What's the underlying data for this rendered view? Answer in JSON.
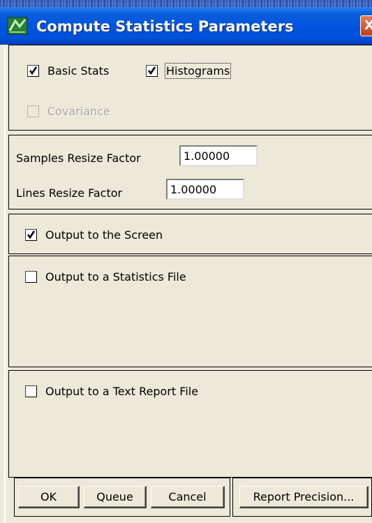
{
  "window": {
    "title": "Compute Statistics Parameters",
    "close_glyph": "X",
    "icon": "envi-app-icon"
  },
  "stats": {
    "basic_stats": {
      "label": "Basic Stats",
      "checked": true
    },
    "histograms": {
      "label": "Histograms",
      "checked": true
    },
    "covariance": {
      "label": "Covariance",
      "checked": false,
      "disabled": true
    }
  },
  "resize": {
    "samples_label": "Samples Resize Factor",
    "samples_value": "1.00000",
    "lines_label": "Lines Resize Factor",
    "lines_value": "1.00000"
  },
  "output_screen": {
    "label": "Output to the Screen",
    "checked": true
  },
  "output_stats_file": {
    "label": "Output to a Statistics File",
    "checked": false
  },
  "output_text_report": {
    "label": "Output to a Text Report File",
    "checked": false
  },
  "buttons": {
    "ok": "OK",
    "queue": "Queue",
    "cancel": "Cancel",
    "report_precision": "Report Precision..."
  }
}
